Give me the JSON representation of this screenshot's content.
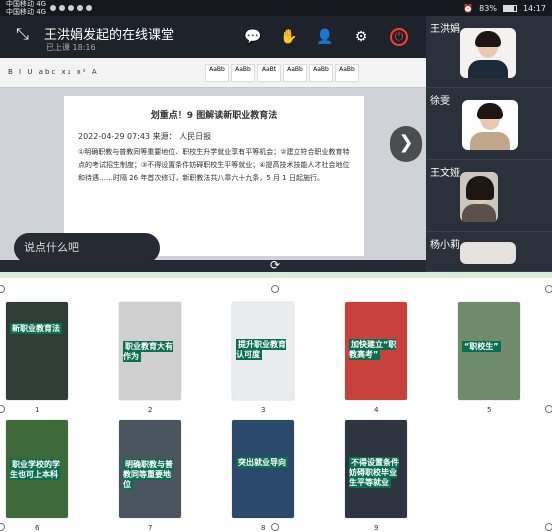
{
  "statusbar": {
    "carrier1": "中国移动 4G",
    "carrier2": "中国移动 4G",
    "battery": "83%",
    "time": "14:17"
  },
  "classroom": {
    "title": "王洪娟发起的在线课堂",
    "time_label": "已上课",
    "time": "18:16"
  },
  "document": {
    "headline": "划重点！9 图解读新职业教育法",
    "meta": "2022-04-29 07:43  来源： 人民日报",
    "para": "①明确职教与普教同等重要地位、职校生升学就业享有平等机会；②建立符合职业教育特点的考试招生制度；③不得设置条件妨碍职校生平等就业；④提高技术技能人才社会地位和待遇……时隔 26 年首次修订，新职教法共八章六十九条，5 月 1 日起施行。"
  },
  "chat": {
    "placeholder": "说点什么吧"
  },
  "participants": [
    {
      "name": "王洪娟"
    },
    {
      "name": "徐雯"
    },
    {
      "name": "王文娅"
    },
    {
      "name": "杨小莉"
    }
  ],
  "thumbnails": [
    {
      "num": "1",
      "headline": "新职业教育法",
      "bg": "#2f3d36"
    },
    {
      "num": "2",
      "headline": "职业教育大有作为",
      "bg": "#cfcfcf"
    },
    {
      "num": "3",
      "headline": "提升职业教育认可度",
      "bg": "#e8ecef"
    },
    {
      "num": "4",
      "headline": "加快建立“职教高考”",
      "bg": "#c9413b"
    },
    {
      "num": "5",
      "headline": "“职校生”",
      "bg": "#6e8c69"
    },
    {
      "num": "6",
      "headline": "职业学校的学生也可上本科",
      "bg": "#3e6a3a"
    },
    {
      "num": "7",
      "headline": "明确职教与普教同等重要地位",
      "bg": "#4a5560"
    },
    {
      "num": "8",
      "headline": "突出就业导向",
      "bg": "#2b4a6b"
    },
    {
      "num": "9",
      "headline": "不得设置条件妨碍职校毕业生平等就业",
      "bg": "#2c3540"
    }
  ]
}
